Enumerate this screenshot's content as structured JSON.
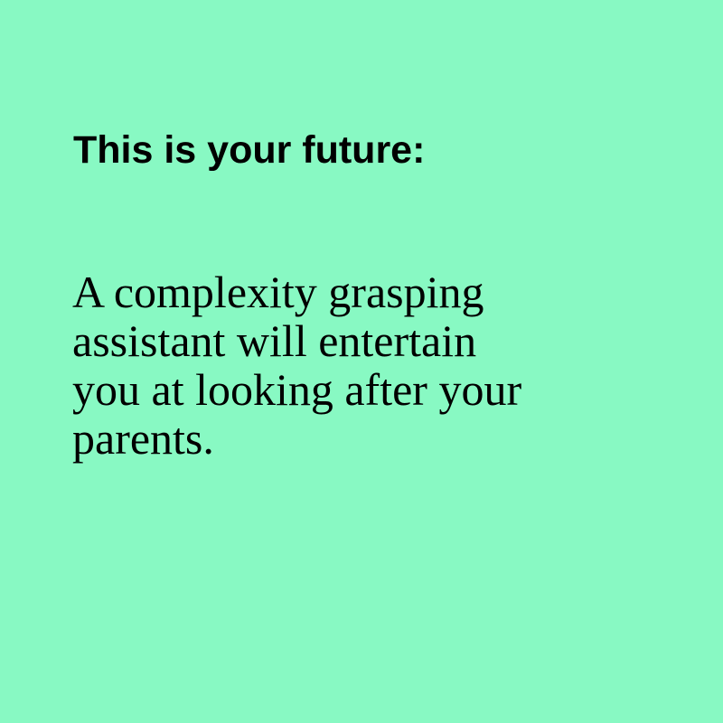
{
  "card": {
    "background_color": "#88f9c3",
    "text_color": "#000000",
    "heading": "This is your future:",
    "body_lines": [
      "A complexity grasping",
      "assistant will entertain",
      "you at looking after your",
      "parents."
    ]
  }
}
